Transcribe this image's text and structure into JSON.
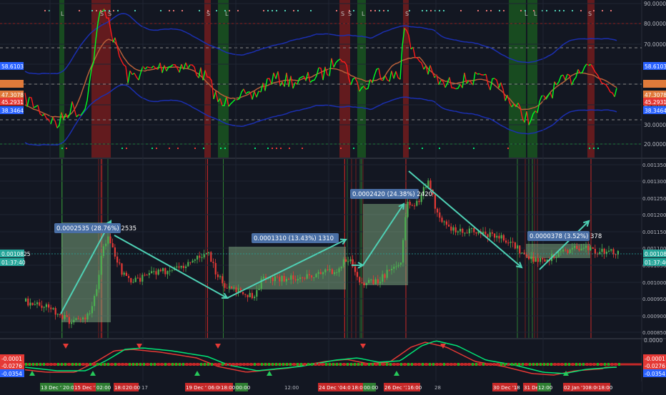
{
  "colors": {
    "background": "#131722",
    "grid": "#1f2433",
    "rsi_green": "#00ff22",
    "rsi_red": "#ff1a1a",
    "band": "#1b2fb0",
    "ma": "#b8603a",
    "arrow": "#4fd1b5",
    "candle_up": "#4caf50",
    "candle_down": "#e53935",
    "measure_box": "#8fbf8f",
    "label_bg": "#4a6fa5"
  },
  "top_pane": {
    "axis_labels": [
      "90.0000",
      "80.0000",
      "70.0000",
      "60.0000",
      "40.0000",
      "30.0000",
      "20.0000"
    ],
    "badges": [
      {
        "text": "58.6103",
        "color": "#2962ff"
      },
      {
        "text": "47.3078",
        "color": "#e07a3a"
      },
      {
        "text": "45.2931",
        "color": "#e53935"
      },
      {
        "text": "38.3464",
        "color": "#2962ff"
      }
    ]
  },
  "mid_pane": {
    "axis_labels": [
      "0.0013500",
      "0.0013000",
      "0.0012500",
      "0.0012000",
      "0.0011500",
      "0.0011000",
      "0.0010500",
      "0.0010000",
      "0.0009500",
      "0.0009000",
      "0.0008500"
    ],
    "badges": [
      {
        "text": "0.0010825",
        "color": "#26a69a"
      },
      {
        "text": "01:37:40",
        "color": "#26a69a"
      }
    ],
    "measurements": [
      {
        "text": "0.0002535 (28.76%) 2535"
      },
      {
        "text": "0.0001310 (13.43%) 1310"
      },
      {
        "text": "0.0002420 (24.38%) 2420"
      },
      {
        "text": "0.0000378 (3.52%) 378"
      }
    ]
  },
  "bottom_pane": {
    "axis_labels": [
      "0.0000"
    ],
    "badges": [
      {
        "text": "-0.0001",
        "color": "#e53935"
      },
      {
        "text": "-0.0276",
        "color": "#e53935"
      },
      {
        "text": "-0.0354",
        "color": "#2962ff"
      }
    ]
  },
  "time_axis": [
    {
      "text": "13 Dec '18",
      "bg": "#2e7d32"
    },
    {
      "text": "20:00",
      "bg": "#2e7d32"
    },
    {
      "text": "15 Dec '18",
      "bg": "#c62828"
    },
    {
      "text": "02:00",
      "bg": "#2e7d32"
    },
    {
      "text": "18:00",
      "bg": "#c62828"
    },
    {
      "text": "20:00",
      "bg": "#c62828"
    },
    {
      "text": "17",
      "bg": ""
    },
    {
      "text": "19 Dec '18",
      "bg": "#c62828"
    },
    {
      "text": "06:00",
      "bg": "#c62828"
    },
    {
      "text": "18:00",
      "bg": "#c62828"
    },
    {
      "text": "00:00",
      "bg": "#2e7d32"
    },
    {
      "text": "12:00",
      "bg": ""
    },
    {
      "text": "24 Dec '18",
      "bg": "#c62828"
    },
    {
      "text": "04:00",
      "bg": "#c62828"
    },
    {
      "text": "18:00",
      "bg": "#c62828"
    },
    {
      "text": "00:00",
      "bg": "#2e7d32"
    },
    {
      "text": "26 Dec '18",
      "bg": "#c62828"
    },
    {
      "text": "16:00",
      "bg": "#c62828"
    },
    {
      "text": "28",
      "bg": ""
    },
    {
      "text": "30 Dec '18",
      "bg": "#c62828"
    },
    {
      "text": "31 Dec '18",
      "bg": "#c62828"
    },
    {
      "text": "12:00",
      "bg": "#2e7d32"
    },
    {
      "text": "02 Jan '19",
      "bg": "#c62828"
    },
    {
      "text": "08:00",
      "bg": "#c62828"
    },
    {
      "text": "18:00",
      "bg": "#c62828"
    }
  ]
}
